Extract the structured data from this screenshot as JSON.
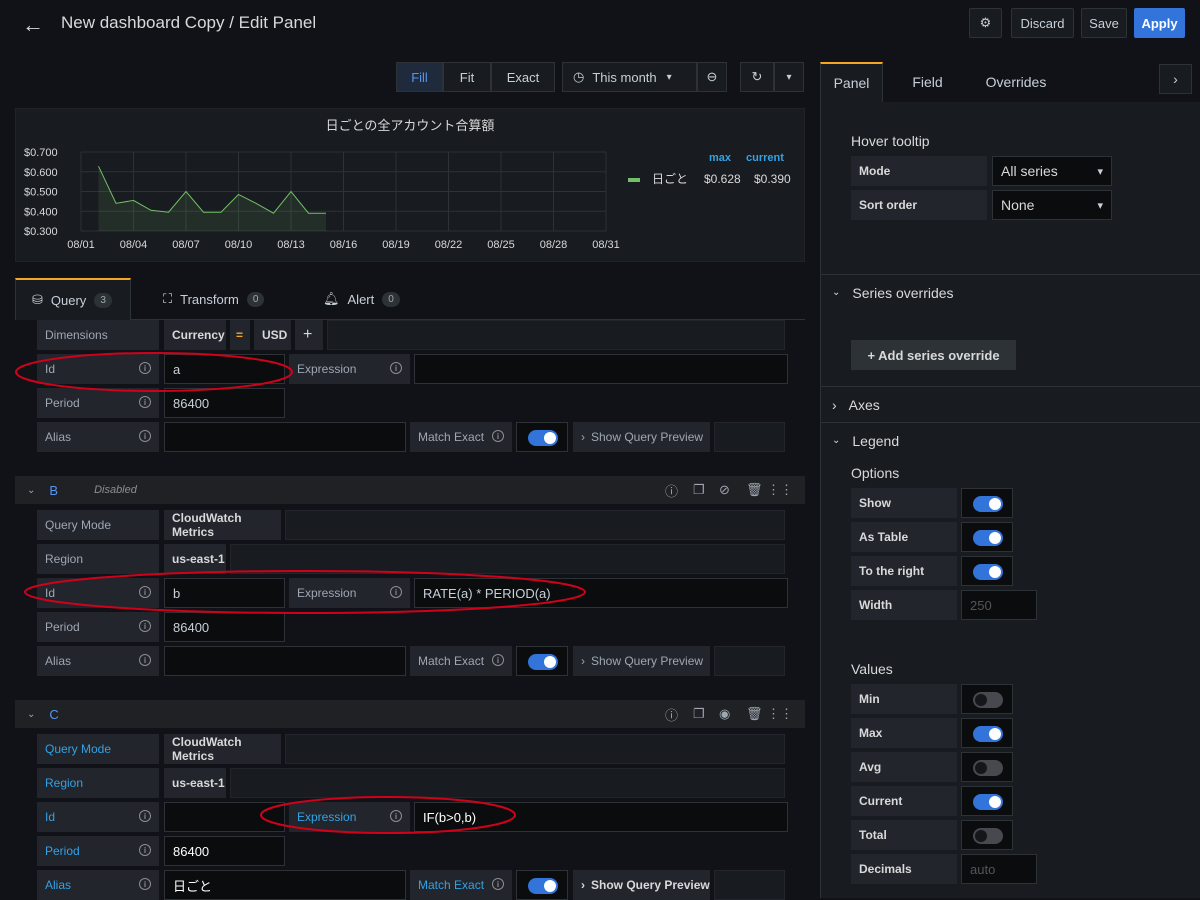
{
  "header": {
    "title": "New dashboard Copy / Edit Panel",
    "discard": "Discard",
    "save": "Save",
    "apply": "Apply"
  },
  "panel_controls": {
    "fill": "Fill",
    "fit": "Fit",
    "exact": "Exact",
    "time_range": "This month"
  },
  "chart_data": {
    "type": "line",
    "title": "日ごとの全アカウント合算額",
    "x": [
      "08/02",
      "08/03",
      "08/04",
      "08/05",
      "08/06",
      "08/07",
      "08/08",
      "08/09",
      "08/10",
      "08/11",
      "08/12",
      "08/13",
      "08/14",
      "08/15"
    ],
    "series": [
      {
        "name": "日ごと",
        "values": [
          0.628,
          0.44,
          0.455,
          0.405,
          0.395,
          0.5,
          0.395,
          0.395,
          0.485,
          0.44,
          0.39,
          0.5,
          0.39,
          0.39
        ]
      }
    ],
    "xticks": [
      "08/01",
      "08/04",
      "08/07",
      "08/10",
      "08/13",
      "08/16",
      "08/19",
      "08/22",
      "08/25",
      "08/28",
      "08/31"
    ],
    "yticks": [
      "$0.700",
      "$0.600",
      "$0.500",
      "$0.400",
      "$0.300"
    ],
    "ylim": [
      0.3,
      0.7
    ],
    "legend": {
      "max_label": "max",
      "current_label": "current",
      "max": "$0.628",
      "current": "$0.390",
      "placement": "right"
    },
    "color": "#73bf69"
  },
  "tabs": {
    "query": "Query",
    "query_count": "3",
    "transform": "Transform",
    "transform_count": "0",
    "alert": "Alert",
    "alert_count": "0"
  },
  "queryA": {
    "dimensions_label": "Dimensions",
    "dim_key": "Currency",
    "dim_op": "=",
    "dim_val": "USD",
    "plus": "+",
    "id_label": "Id",
    "id_value": "a",
    "expression_label": "Expression",
    "expression_value": "",
    "period_label": "Period",
    "period_value": "86400",
    "alias_label": "Alias",
    "alias_value": "",
    "match_exact_label": "Match Exact",
    "show_preview": "Show Query Preview"
  },
  "queryB": {
    "name": "B",
    "status": "Disabled",
    "query_mode_label": "Query Mode",
    "query_mode_value": "CloudWatch Metrics",
    "region_label": "Region",
    "region_value": "us-east-1",
    "id_label": "Id",
    "id_value": "b",
    "expression_label": "Expression",
    "expression_value": "RATE(a) * PERIOD(a)",
    "period_label": "Period",
    "period_value": "86400",
    "alias_label": "Alias",
    "alias_value": "",
    "match_exact_label": "Match Exact",
    "show_preview": "Show Query Preview"
  },
  "queryC": {
    "name": "C",
    "query_mode_label": "Query Mode",
    "query_mode_value": "CloudWatch Metrics",
    "region_label": "Region",
    "region_value": "us-east-1",
    "id_label": "Id",
    "id_value": "",
    "expression_label": "Expression",
    "expression_value": "IF(b>0,b)",
    "period_label": "Period",
    "period_value": "86400",
    "alias_label": "Alias",
    "alias_value": "日ごと",
    "match_exact_label": "Match Exact",
    "show_preview": "Show Query Preview"
  },
  "right": {
    "tab_panel": "Panel",
    "tab_field": "Field",
    "tab_overrides": "Overrides",
    "hover_tooltip": "Hover tooltip",
    "mode_label": "Mode",
    "mode_value": "All series",
    "sort_label": "Sort order",
    "sort_value": "None",
    "series_overrides": "Series overrides",
    "add_override": "+ Add series override",
    "axes": "Axes",
    "legend": "Legend",
    "options": "Options",
    "show": "Show",
    "as_table": "As Table",
    "to_right": "To the right",
    "width": "Width",
    "width_placeholder": "250",
    "values": "Values",
    "min": "Min",
    "max": "Max",
    "avg": "Avg",
    "current": "Current",
    "total": "Total",
    "decimals": "Decimals",
    "decimals_placeholder": "auto"
  }
}
